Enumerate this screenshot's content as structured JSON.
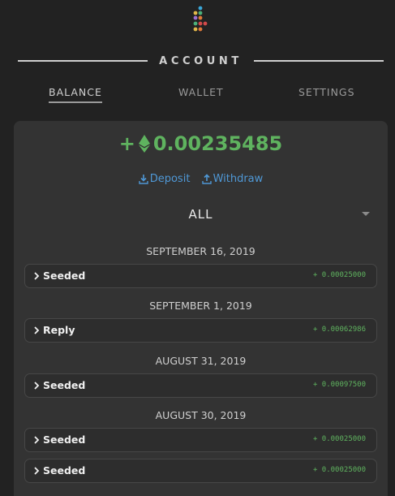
{
  "header": {
    "title": "ACCOUNT"
  },
  "tabs": [
    {
      "label": "BALANCE",
      "active": true
    },
    {
      "label": "WALLET",
      "active": false
    },
    {
      "label": "SETTINGS",
      "active": false
    }
  ],
  "balance": {
    "prefix": "+",
    "currency_icon": "ethereum-icon",
    "amount": "0.00235485",
    "color": "#5fb35f"
  },
  "actions": {
    "deposit_label": "Deposit",
    "withdraw_label": "Withdraw",
    "link_color": "#4f98d6"
  },
  "filter": {
    "selected": "ALL"
  },
  "transactions": [
    {
      "date": "SEPTEMBER 16, 2019",
      "label": "Seeded",
      "amount": "+ 0.00025000"
    },
    {
      "date": "SEPTEMBER 1, 2019",
      "label": "Reply",
      "amount": "+ 0.00062986"
    },
    {
      "date": "AUGUST 31, 2019",
      "label": "Seeded",
      "amount": "+ 0.00097500"
    },
    {
      "date": "AUGUST 30, 2019",
      "label": "Seeded",
      "amount": "+ 0.00025000"
    },
    {
      "date": "",
      "label": "Seeded",
      "amount": "+ 0.00025000"
    }
  ]
}
